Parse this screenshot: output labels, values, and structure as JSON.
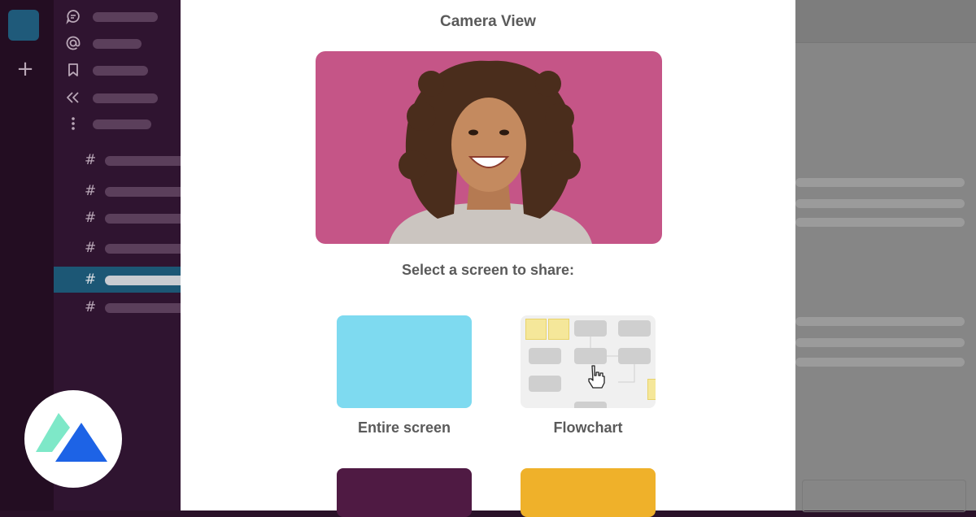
{
  "modal": {
    "title": "Camera View",
    "prompt": "Select a screen to share:",
    "options": [
      {
        "label": "Entire screen"
      },
      {
        "label": "Flowchart"
      },
      {
        "label": ""
      },
      {
        "label": ""
      }
    ]
  },
  "sidebar": {
    "nav_items": [
      {
        "icon": "threads-icon"
      },
      {
        "icon": "mention-icon"
      },
      {
        "icon": "bookmark-icon"
      },
      {
        "icon": "connect-icon"
      },
      {
        "icon": "more-icon"
      }
    ],
    "channels": [
      {
        "active": false
      },
      {
        "active": false
      },
      {
        "active": false
      },
      {
        "active": false
      },
      {
        "active": true
      },
      {
        "active": false
      }
    ]
  },
  "colors": {
    "rail": "#230d22",
    "sidebar": "#2f1430",
    "active_channel": "#1c5775",
    "camera_bg": "#c55587",
    "entire_screen": "#7edaf0",
    "option_plum": "#4f1a43",
    "option_amber": "#efb12a"
  }
}
